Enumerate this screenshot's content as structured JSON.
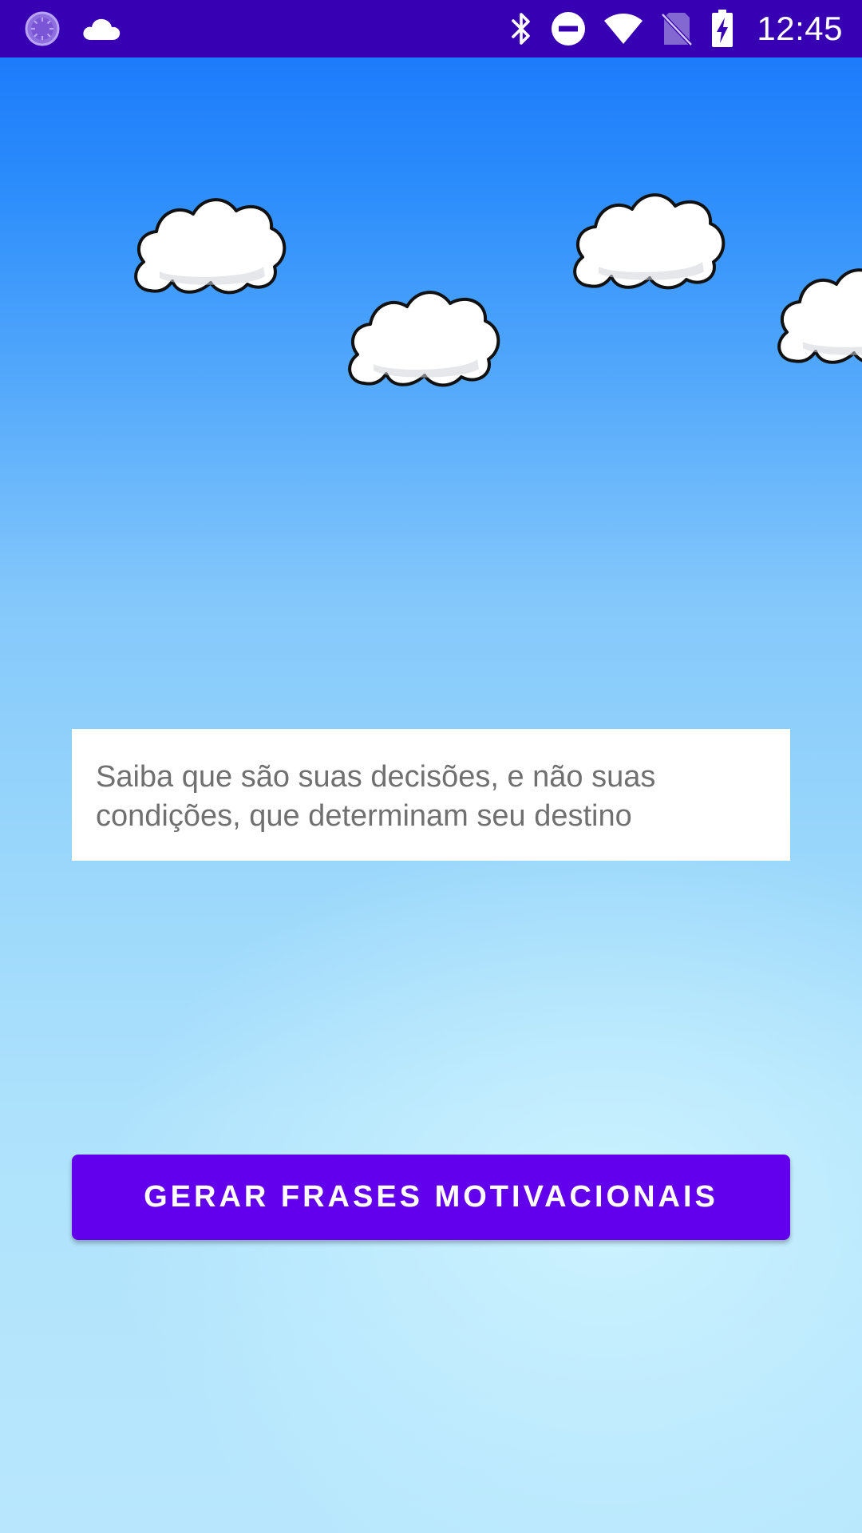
{
  "status_bar": {
    "time": "12:45",
    "background_color": "#3700b3",
    "left_icons": [
      "loading-spinner-icon",
      "cloud-icon"
    ],
    "right_icons": [
      "bluetooth-icon",
      "do-not-disturb-icon",
      "wifi-icon",
      "no-sim-icon",
      "battery-charging-icon"
    ]
  },
  "background": {
    "sky_top_color": "#1674fb",
    "sky_bottom_color": "#b8e7fd",
    "decorations": [
      "cloud",
      "cloud",
      "cloud",
      "cloud"
    ]
  },
  "quote": {
    "text": "Saiba que são suas decisões, e não suas condições, que determinam seu destino"
  },
  "actions": {
    "generate_label": "GERAR FRASES MOTIVACIONAIS",
    "button_color": "#6200ee"
  }
}
